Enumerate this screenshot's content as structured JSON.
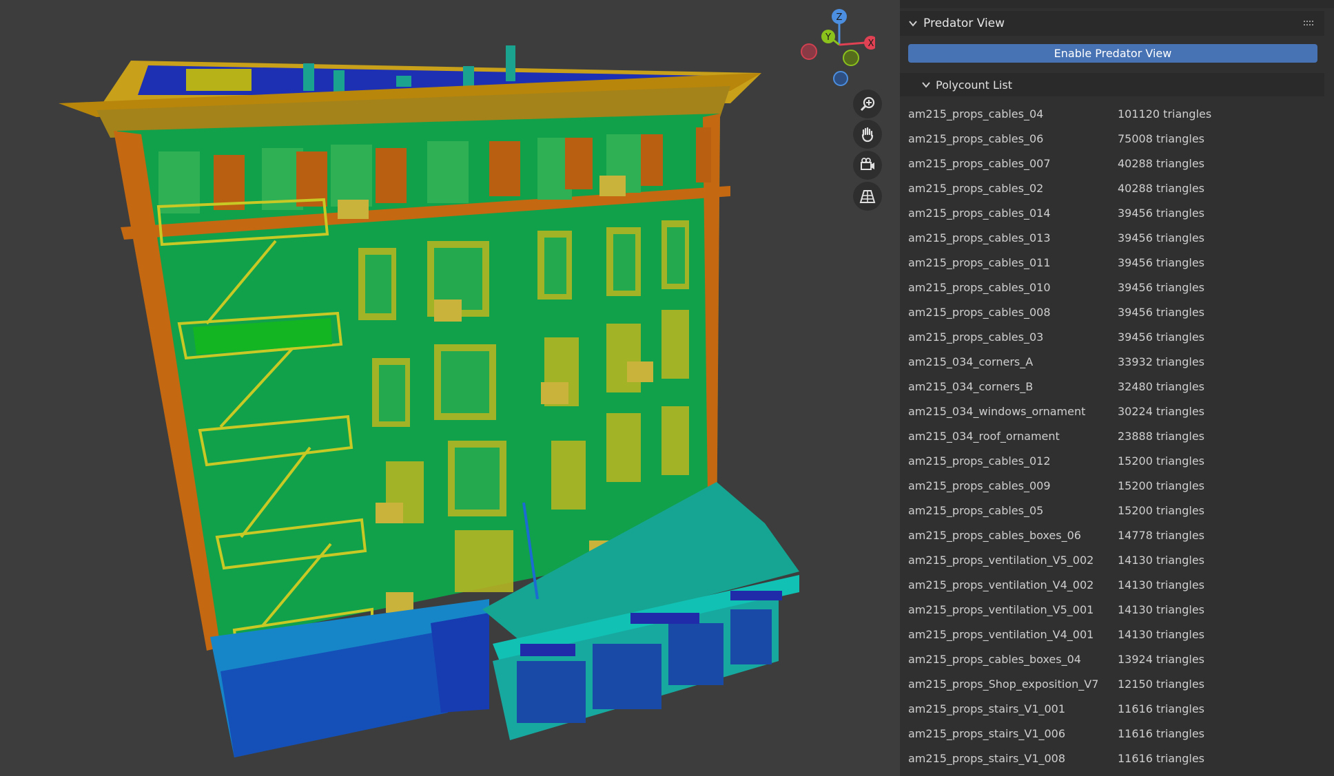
{
  "viewport": {
    "gizmo_axes": {
      "z": "Z",
      "y": "Y",
      "x": "X"
    },
    "buttons": [
      {
        "icon": "zoom-icon"
      },
      {
        "icon": "pan-hand-icon"
      },
      {
        "icon": "camera-view-icon"
      },
      {
        "icon": "perspective-grid-icon"
      }
    ]
  },
  "panel": {
    "title": "Predator View",
    "enable_button": "Enable Predator View",
    "list_title": "Polycount List",
    "items": [
      {
        "name": "am215_props_cables_04",
        "count": "101120 triangles"
      },
      {
        "name": "am215_props_cables_06",
        "count": "75008 triangles"
      },
      {
        "name": "am215_props_cables_007",
        "count": "40288 triangles"
      },
      {
        "name": "am215_props_cables_02",
        "count": "40288 triangles"
      },
      {
        "name": "am215_props_cables_014",
        "count": "39456 triangles"
      },
      {
        "name": "am215_props_cables_013",
        "count": "39456 triangles"
      },
      {
        "name": "am215_props_cables_011",
        "count": "39456 triangles"
      },
      {
        "name": "am215_props_cables_010",
        "count": "39456 triangles"
      },
      {
        "name": "am215_props_cables_008",
        "count": "39456 triangles"
      },
      {
        "name": "am215_props_cables_03",
        "count": "39456 triangles"
      },
      {
        "name": "am215_034_corners_A",
        "count": "33932 triangles"
      },
      {
        "name": "am215_034_corners_B",
        "count": "32480 triangles"
      },
      {
        "name": "am215_034_windows_ornament",
        "count": "30224 triangles"
      },
      {
        "name": "am215_034_roof_ornament",
        "count": "23888 triangles"
      },
      {
        "name": "am215_props_cables_012",
        "count": "15200 triangles"
      },
      {
        "name": "am215_props_cables_009",
        "count": "15200 triangles"
      },
      {
        "name": "am215_props_cables_05",
        "count": "15200 triangles"
      },
      {
        "name": "am215_props_cables_boxes_06",
        "count": "14778 triangles"
      },
      {
        "name": "am215_props_ventilation_V5_002",
        "count": "14130 triangles"
      },
      {
        "name": "am215_props_ventilation_V4_002",
        "count": "14130 triangles"
      },
      {
        "name": "am215_props_ventilation_V5_001",
        "count": "14130 triangles"
      },
      {
        "name": "am215_props_ventilation_V4_001",
        "count": "14130 triangles"
      },
      {
        "name": "am215_props_cables_boxes_04",
        "count": "13924 triangles"
      },
      {
        "name": "am215_props_Shop_exposition_V7",
        "count": "12150 triangles"
      },
      {
        "name": "am215_props_stairs_V1_001",
        "count": "11616 triangles"
      },
      {
        "name": "am215_props_stairs_V1_006",
        "count": "11616 triangles"
      },
      {
        "name": "am215_props_stairs_V1_008",
        "count": "11616 triangles"
      }
    ]
  }
}
